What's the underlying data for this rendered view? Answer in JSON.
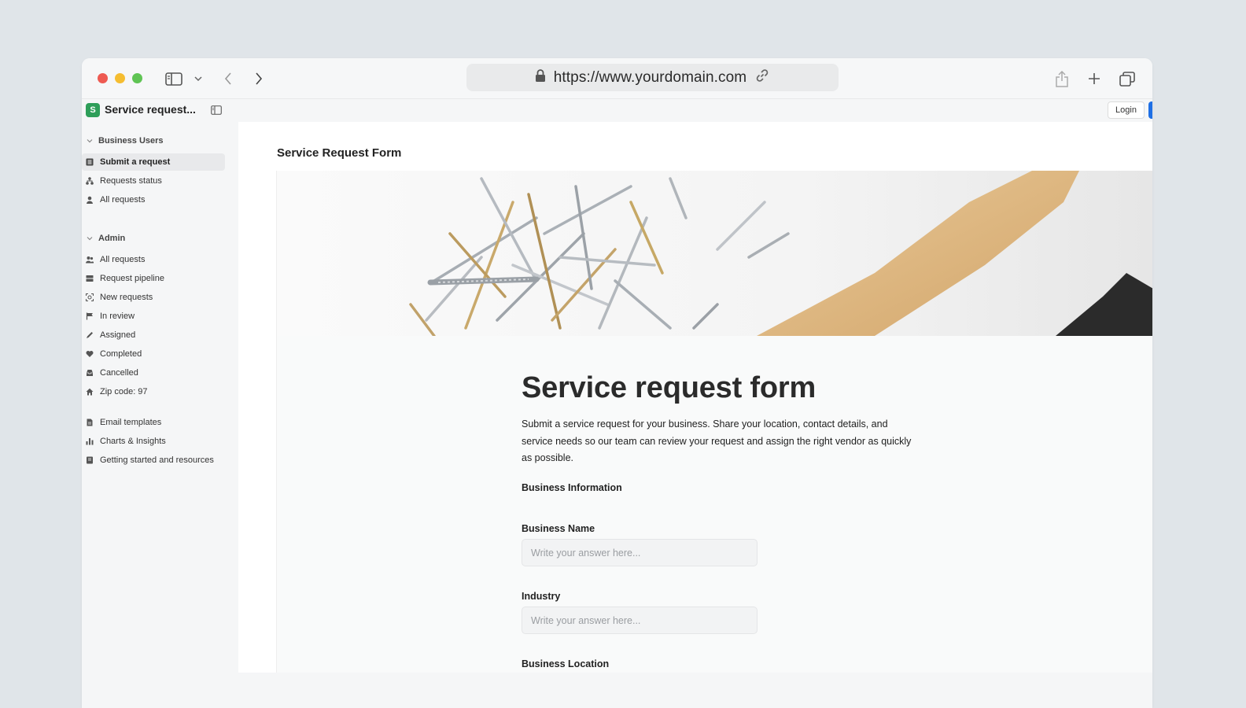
{
  "browser": {
    "url": "https://www.yourdomain.com"
  },
  "app": {
    "logo_letter": "S",
    "title": "Service request...",
    "login_label": "Login"
  },
  "sidebar": {
    "sections": [
      {
        "title": "Business Users",
        "items": [
          {
            "label": "Submit a request",
            "icon": "list-icon",
            "active": true
          },
          {
            "label": "Requests status",
            "icon": "hierarchy-icon"
          },
          {
            "label": "All requests",
            "icon": "user-icon"
          }
        ]
      },
      {
        "title": "Admin",
        "items": [
          {
            "label": "All requests",
            "icon": "users-icon"
          },
          {
            "label": "Request pipeline",
            "icon": "kanban-icon"
          },
          {
            "label": "New requests",
            "icon": "scan-icon"
          },
          {
            "label": "In review",
            "icon": "flag-icon"
          },
          {
            "label": "Assigned",
            "icon": "pencil-icon"
          },
          {
            "label": "Completed",
            "icon": "heart-icon"
          },
          {
            "label": "Cancelled",
            "icon": "inbox-icon"
          },
          {
            "label": "Zip code: 97",
            "icon": "home-icon"
          }
        ]
      },
      {
        "title": "",
        "items": [
          {
            "label": "Email templates",
            "icon": "document-icon"
          },
          {
            "label": "Charts & Insights",
            "icon": "bar-chart-icon"
          },
          {
            "label": "Getting started and resources",
            "icon": "book-icon"
          }
        ]
      }
    ]
  },
  "main": {
    "page_heading": "Service Request Form",
    "form": {
      "title": "Service request form",
      "description": "Submit a service request for your business. Share your location, contact details, and service needs so our team can review your request and assign the right vendor as quickly as possible.",
      "group_title": "Business Information",
      "fields": [
        {
          "label": "Business Name",
          "placeholder": "Write your answer here..."
        },
        {
          "label": "Industry",
          "placeholder": "Write your answer here..."
        }
      ],
      "next_group_title": "Business Location"
    }
  }
}
